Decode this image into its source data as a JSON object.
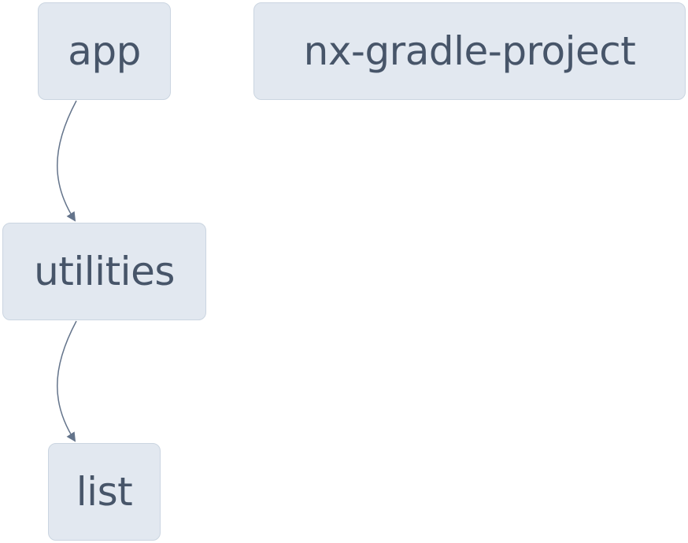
{
  "graph": {
    "nodes": [
      {
        "id": "app",
        "label": "app"
      },
      {
        "id": "nx-gradle-project",
        "label": "nx-gradle-project"
      },
      {
        "id": "utilities",
        "label": "utilities"
      },
      {
        "id": "list",
        "label": "list"
      }
    ],
    "edges": [
      {
        "from": "app",
        "to": "utilities"
      },
      {
        "from": "utilities",
        "to": "list"
      }
    ]
  },
  "colors": {
    "node_fill": "#e2e8f0",
    "node_border": "#cbd5e1",
    "node_text": "#475569",
    "edge": "#64748b"
  }
}
